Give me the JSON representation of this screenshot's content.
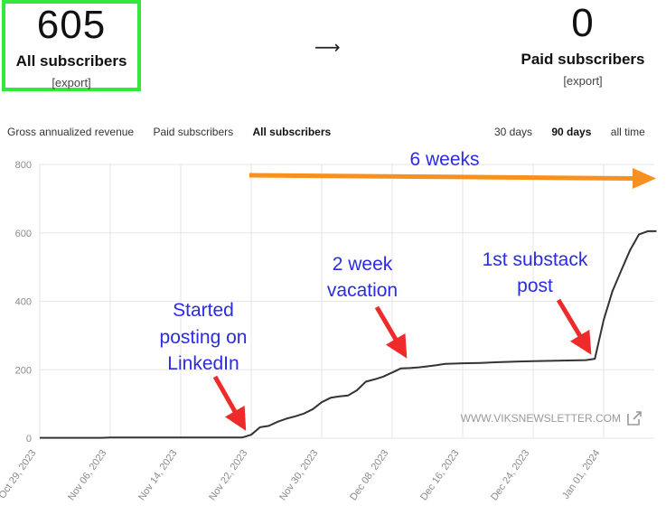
{
  "header": {
    "all_subscribers": {
      "value": "605",
      "label": "All subscribers",
      "export": "[export]"
    },
    "arrow": "⟶",
    "paid_subscribers": {
      "value": "0",
      "label": "Paid subscribers",
      "export": "[export]"
    }
  },
  "tabs": {
    "left": [
      "Gross annualized revenue",
      "Paid subscribers",
      "All subscribers"
    ],
    "left_active": 2,
    "right": [
      "30 days",
      "90 days",
      "all time"
    ],
    "right_active": 1
  },
  "annotations": {
    "six_weeks": "6 weeks",
    "linkedin": [
      "Started",
      "posting on",
      "LinkedIn"
    ],
    "vacation": [
      "2 week",
      "vacation"
    ],
    "substack": [
      "1st substack",
      "post"
    ]
  },
  "watermark": "WWW.VIKSNEWSLETTER.COM",
  "colors": {
    "line": "#333333",
    "grid": "#e6e6e6",
    "annotation": "#2b2be6",
    "arrow_red": "#ee2a2a",
    "arrow_orange": "#f7901e",
    "highlight": "#33e83a"
  },
  "chart_data": {
    "type": "line",
    "title": "",
    "xlabel": "",
    "ylabel": "",
    "ylim": [
      0,
      800
    ],
    "yticks": [
      0,
      200,
      400,
      600,
      800
    ],
    "xticks": [
      "Oct 29, 2023",
      "Nov 06, 2023",
      "Nov 14, 2023",
      "Nov 22, 2023",
      "Nov 30, 2023",
      "Dec 08, 2023",
      "Dec 16, 2023",
      "Dec 24, 2023",
      "Jan 01, 2024"
    ],
    "grid": true,
    "series": [
      {
        "name": "",
        "x": [
          "2023-10-29",
          "2023-11-05",
          "2023-11-06",
          "2023-11-21",
          "2023-11-22",
          "2023-11-23",
          "2023-11-24",
          "2023-11-25",
          "2023-11-26",
          "2023-11-27",
          "2023-11-28",
          "2023-11-29",
          "2023-11-30",
          "2023-12-01",
          "2023-12-02",
          "2023-12-03",
          "2023-12-04",
          "2023-12-05",
          "2023-12-06",
          "2023-12-07",
          "2023-12-08",
          "2023-12-09",
          "2023-12-10",
          "2023-12-11",
          "2023-12-12",
          "2023-12-13",
          "2023-12-14",
          "2023-12-16",
          "2023-12-18",
          "2023-12-20",
          "2023-12-22",
          "2023-12-24",
          "2023-12-26",
          "2023-12-28",
          "2023-12-30",
          "2023-12-31",
          "2024-01-01",
          "2024-01-02",
          "2024-01-03",
          "2024-01-04",
          "2024-01-05",
          "2024-01-06",
          "2024-01-07"
        ],
        "values": [
          1,
          1,
          2,
          2,
          10,
          32,
          36,
          48,
          57,
          64,
          72,
          85,
          105,
          118,
          122,
          125,
          140,
          165,
          172,
          180,
          192,
          204,
          205,
          207,
          210,
          213,
          217,
          219,
          220,
          222,
          224,
          225,
          226,
          227,
          228,
          232,
          345,
          430,
          490,
          550,
          595,
          605,
          605
        ]
      }
    ]
  }
}
